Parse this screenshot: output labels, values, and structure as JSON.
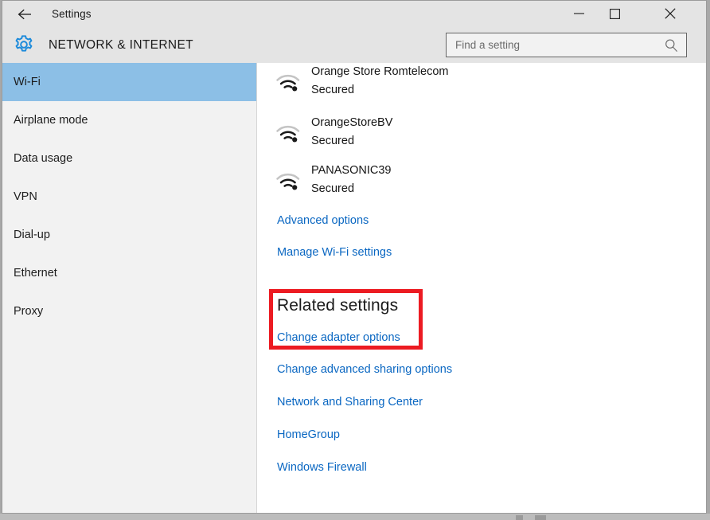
{
  "window": {
    "titlebar": {
      "back_icon": "back-arrow-icon",
      "title": "Settings",
      "minimize_label": "Minimize",
      "maximize_label": "Maximize",
      "close_label": "Close"
    },
    "header": {
      "icon": "gear-icon",
      "title": "NETWORK & INTERNET"
    },
    "search": {
      "placeholder": "Find a setting",
      "value": "",
      "icon": "search-icon"
    }
  },
  "sidebar": {
    "items": [
      {
        "label": "Wi-Fi",
        "selected": true
      },
      {
        "label": "Airplane mode",
        "selected": false
      },
      {
        "label": "Data usage",
        "selected": false
      },
      {
        "label": "VPN",
        "selected": false
      },
      {
        "label": "Dial-up",
        "selected": false
      },
      {
        "label": "Ethernet",
        "selected": false
      },
      {
        "label": "Proxy",
        "selected": false
      }
    ],
    "selected_color": "#8cbfe6"
  },
  "content": {
    "networks": [
      {
        "name": "Orange Store Romtelecom",
        "status": "Secured",
        "icon": "wifi-signal-icon"
      },
      {
        "name": "OrangeStoreBV",
        "status": "Secured",
        "icon": "wifi-signal-icon"
      },
      {
        "name": "PANASONIC39",
        "status": "Secured",
        "icon": "wifi-signal-icon"
      }
    ],
    "wifi_links": [
      {
        "label": "Advanced options"
      },
      {
        "label": "Manage Wi-Fi settings"
      }
    ],
    "related_settings": {
      "heading": "Related settings",
      "highlighted_link": "Change adapter options",
      "links": [
        {
          "label": "Change advanced sharing options"
        },
        {
          "label": "Network and Sharing Center"
        },
        {
          "label": "HomeGroup"
        },
        {
          "label": "Windows Firewall"
        }
      ]
    },
    "link_color": "#0a67c2",
    "highlight_color": "#ec1b22"
  }
}
